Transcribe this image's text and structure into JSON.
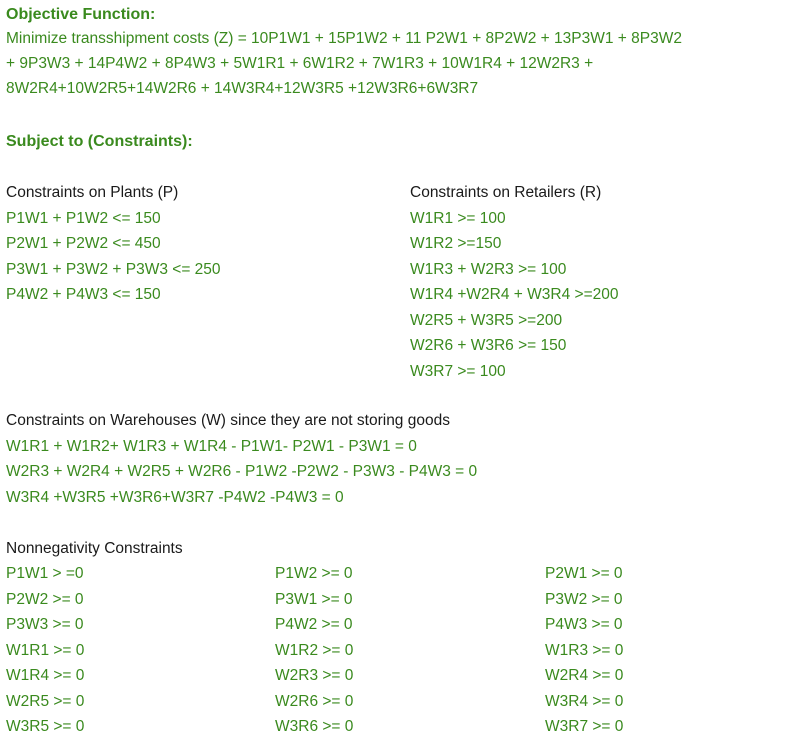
{
  "objective": {
    "heading": "Objective Function:",
    "lines": [
      "Minimize transshipment costs (Z) = 10P1W1 + 15P1W2 + 11 P2W1 + 8P2W2 + 13P3W1 + 8P3W2",
      "+ 9P3W3 + 14P4W2 + 8P4W3 + 5W1R1 + 6W1R2 + 7W1R3 + 10W1R4 + 12W2R3 +",
      "8W2R4+10W2R5+14W2R6 + 14W3R4+12W3R5 +12W3R6+6W3R7"
    ]
  },
  "constraints": {
    "heading": "Subject to (Constraints):",
    "plants": {
      "title": "Constraints on Plants (P)",
      "items": [
        "P1W1 + P1W2 <= 150",
        "P2W1 + P2W2 <= 450",
        "P3W1 + P3W2 + P3W3 <= 250",
        "P4W2 + P4W3 <= 150"
      ]
    },
    "retailers": {
      "title": "Constraints on Retailers (R)",
      "items": [
        "W1R1 >= 100",
        "W1R2 >=150",
        "W1R3 + W2R3 >= 100",
        "W1R4 +W2R4 + W3R4 >=200",
        "W2R5 + W3R5 >=200",
        "W2R6 + W3R6 >= 150",
        "W3R7 >= 100"
      ]
    },
    "warehouses": {
      "title": "Constraints on Warehouses (W) since they are not storing goods",
      "items": [
        "W1R1 + W1R2+ W1R3 + W1R4 - P1W1- P2W1 - P3W1 = 0",
        "W2R3 + W2R4 + W2R5 + W2R6 - P1W2 -P2W2 - P3W3 - P4W3 = 0",
        "W3R4 +W3R5 +W3R6+W3R7 -P4W2 -P4W3 = 0"
      ]
    },
    "nonnegativity": {
      "title": "Nonnegativity Constraints",
      "columns": [
        [
          "P1W1 > =0",
          "P2W2 >= 0",
          "P3W3 >= 0",
          "W1R1 >= 0",
          "W1R4 >= 0",
          "W2R5 >= 0",
          "W3R5 >= 0"
        ],
        [
          "P1W2 >= 0",
          "P3W1 >= 0",
          "P4W2 >= 0",
          "W1R2 >= 0",
          "W2R3 >= 0",
          "W2R6 >= 0",
          "W3R6 >= 0"
        ],
        [
          "P2W1 >= 0",
          "P3W2 >= 0",
          "P4W3 >= 0",
          "W1R3 >= 0",
          "W2R4 >= 0",
          "W3R4 >= 0",
          "W3R7 >= 0"
        ]
      ]
    }
  },
  "colors": {
    "green_text": "#3a8a1e",
    "black_text": "#1a1a1a"
  }
}
